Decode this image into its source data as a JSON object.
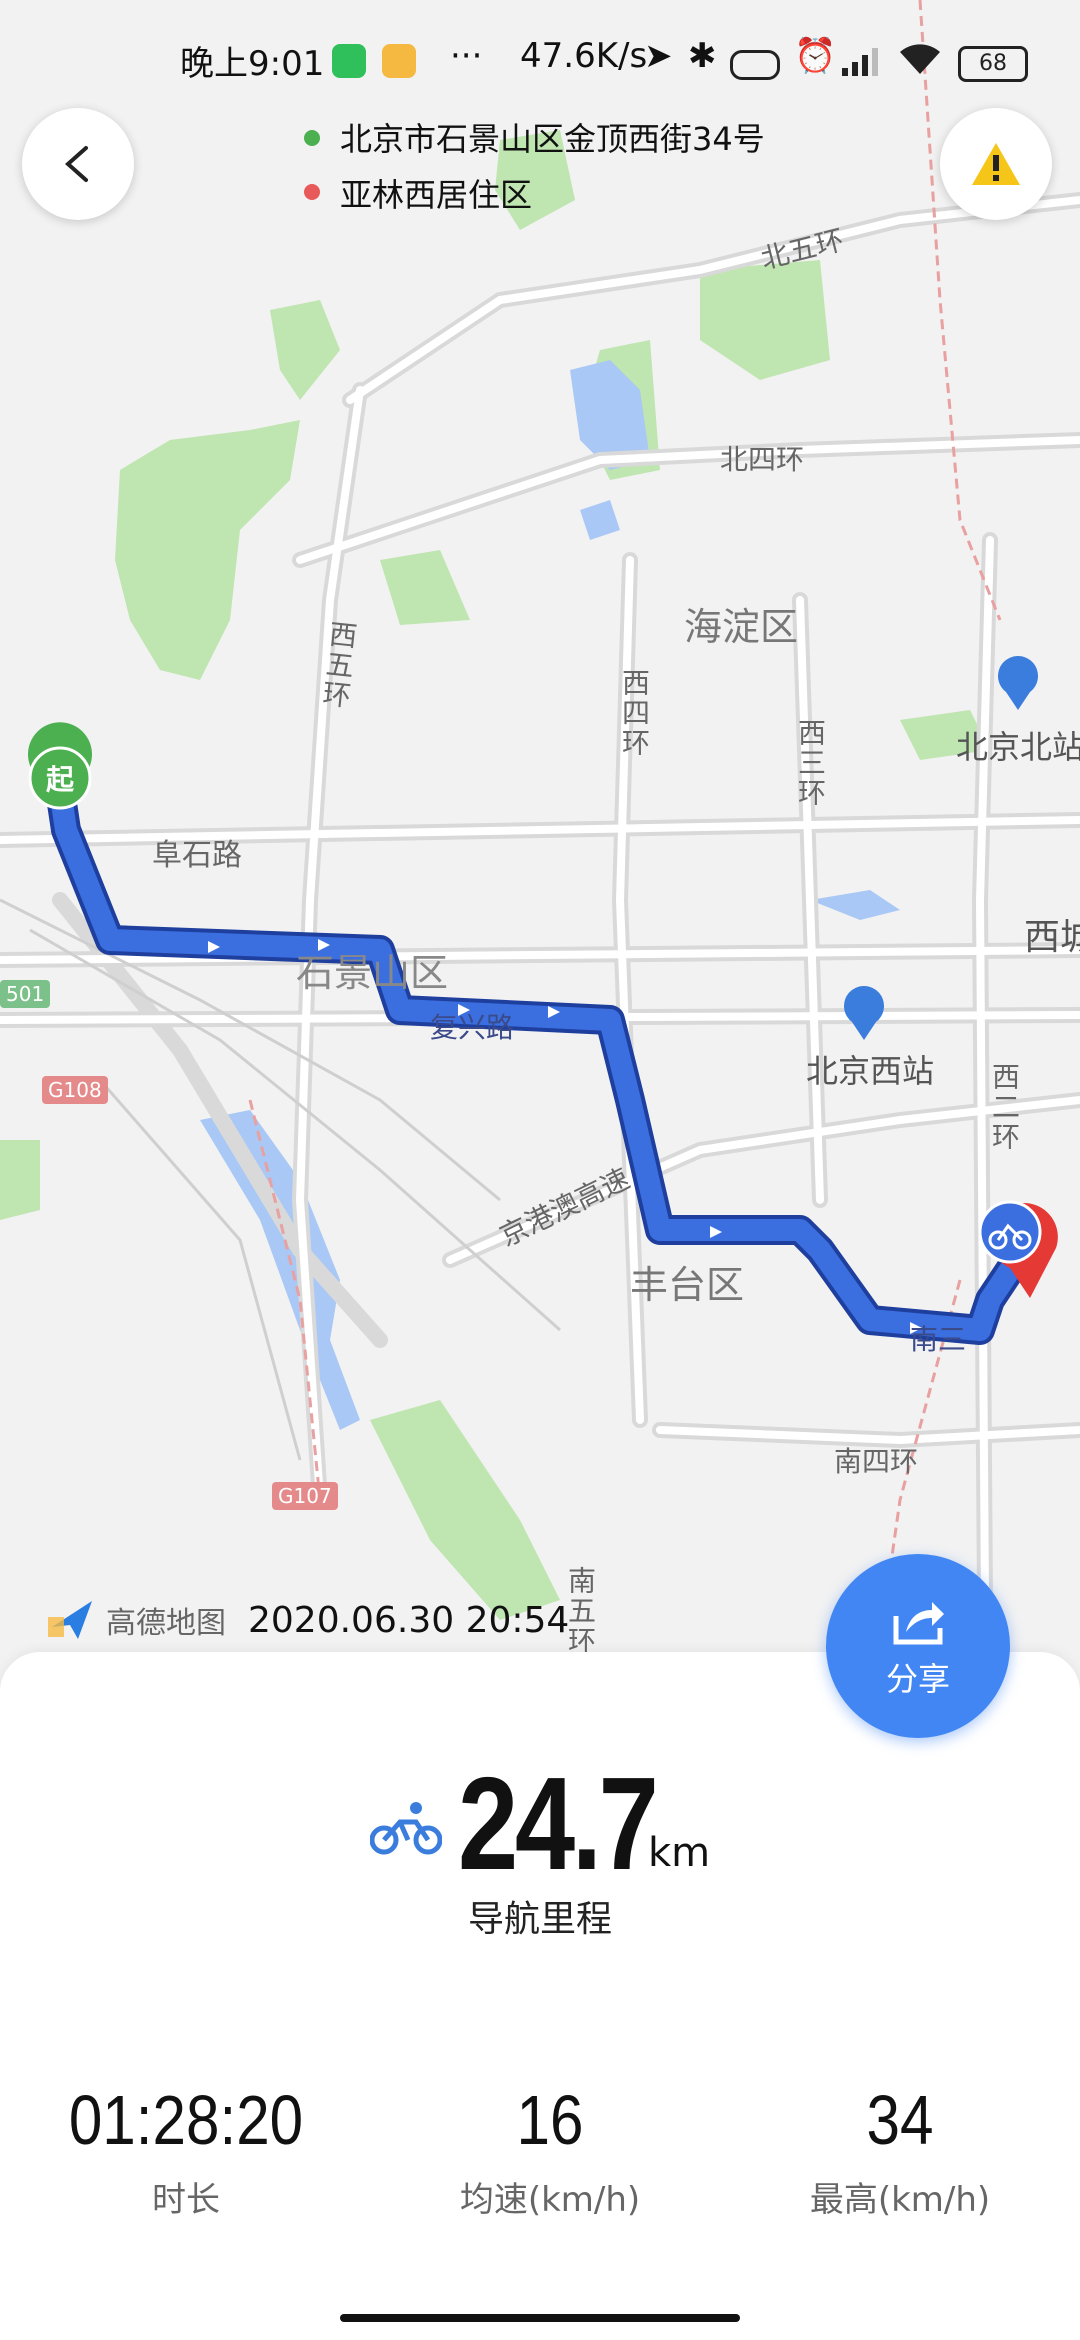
{
  "status_bar": {
    "time": "晚上9:01",
    "dots": "···",
    "net_speed": "47.6K/s",
    "battery": "68"
  },
  "route": {
    "start_address": "北京市石景山区金顶西街34号",
    "end_address": "亚林西居住区",
    "start_marker": "起",
    "start_color": "#4caf50",
    "end_color": "#e85a5a",
    "route_color": "#3b6fe0"
  },
  "map_labels": {
    "bei_wu_huan": "北五环",
    "bei_si_huan": "北四环",
    "xi_wu_huan": "西五环",
    "xi_si_huan": "西四环",
    "xi_san_huan": "西三环",
    "xi_er_huan": "西二环",
    "haidian": "海淀区",
    "fengtai": "丰台区",
    "shijingshan": "石景山区",
    "fushi_road": "阜石路",
    "beijing_north": "北京北站",
    "beijing_west": "北京西站",
    "jinggangao": "京港澳高速",
    "nan_si_huan": "南四环",
    "nan_wu_huan": "南五环",
    "xi_cheng": "西城",
    "g108": "G108",
    "g107": "G107",
    "s501": "501",
    "fuxing_road": "复兴路",
    "nan_san": "南三"
  },
  "map_footer": {
    "brand": "高德地图",
    "datetime": "2020.06.30 20:54"
  },
  "share": {
    "label": "分享"
  },
  "summary": {
    "distance_value": "24.7",
    "distance_unit": "km",
    "distance_label": "导航里程",
    "duration_value": "01:28:20",
    "duration_label": "时长",
    "avg_speed_value": "16",
    "avg_speed_label": "均速(km/h)",
    "max_speed_value": "34",
    "max_speed_label": "最高(km/h)"
  },
  "colors": {
    "accent": "#4286f4",
    "park": "#bfe5b0",
    "water": "#a9c8f5"
  }
}
